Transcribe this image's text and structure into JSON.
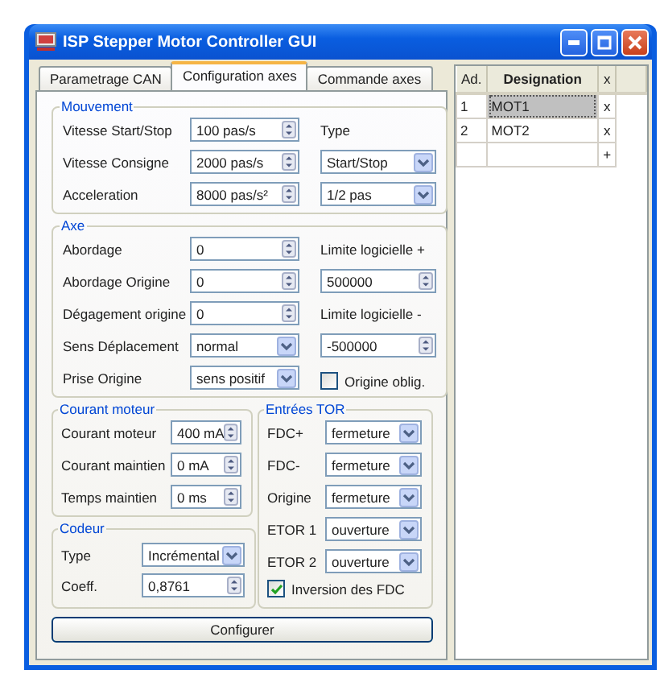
{
  "window": {
    "title": "ISP Stepper Motor Controller GUI"
  },
  "tabs": [
    {
      "label": "Parametrage CAN",
      "selected": false
    },
    {
      "label": "Configuration axes",
      "selected": true
    },
    {
      "label": "Commande axes",
      "selected": false
    }
  ],
  "groups": [
    {
      "title": "Mouvement",
      "rows": [
        {
          "label": "Vitesse Start/Stop",
          "field": {
            "kind": "spin",
            "value": "100 pas/s"
          },
          "side": {
            "kind": "label",
            "text": "Type"
          }
        },
        {
          "label": "Vitesse Consigne",
          "field": {
            "kind": "spin",
            "value": "2000 pas/s"
          },
          "side": {
            "kind": "combo",
            "value": "Start/Stop"
          }
        },
        {
          "label": "Acceleration",
          "field": {
            "kind": "spin",
            "value": "8000 pas/s²"
          },
          "side": {
            "kind": "combo",
            "value": "1/2 pas"
          }
        }
      ]
    },
    {
      "title": "Axe",
      "rows": [
        {
          "label": "Abordage",
          "field": {
            "kind": "spin",
            "value": "0"
          },
          "side": {
            "kind": "label",
            "text": "Limite logicielle +"
          }
        },
        {
          "label": "Abordage Origine",
          "field": {
            "kind": "spin",
            "value": "0"
          },
          "side": {
            "kind": "spin",
            "value": "500000"
          }
        },
        {
          "label": "Dégagement origine",
          "field": {
            "kind": "spin",
            "value": "0"
          },
          "side": {
            "kind": "label",
            "text": "Limite logicielle -"
          }
        },
        {
          "label": "Sens Déplacement",
          "field": {
            "kind": "combo",
            "value": "normal"
          },
          "side": {
            "kind": "spin",
            "value": "-500000"
          }
        },
        {
          "label": "Prise Origine",
          "field": {
            "kind": "combo",
            "value": "sens positif"
          },
          "side": {
            "kind": "check",
            "text": "Origine oblig.",
            "checked": false
          }
        }
      ]
    }
  ],
  "courant": {
    "title": "Courant moteur",
    "rows": [
      {
        "label": "Courant moteur",
        "field": {
          "kind": "spin",
          "value": "400 mA"
        }
      },
      {
        "label": "Courant maintien",
        "field": {
          "kind": "spin",
          "value": "0 mA"
        }
      },
      {
        "label": "Temps maintien",
        "field": {
          "kind": "spin",
          "value": "0 ms"
        }
      }
    ]
  },
  "codeur": {
    "title": "Codeur",
    "rows": [
      {
        "label": "Type",
        "field": {
          "kind": "combo",
          "value": "Incrémental"
        }
      },
      {
        "label": "Coeff.",
        "field": {
          "kind": "spin",
          "value": "0,8761"
        }
      }
    ]
  },
  "entrees": {
    "title": "Entrées TOR",
    "rows": [
      {
        "label": "FDC+",
        "field": {
          "kind": "combo",
          "value": "fermeture"
        }
      },
      {
        "label": "FDC-",
        "field": {
          "kind": "combo",
          "value": "fermeture"
        }
      },
      {
        "label": "Origine",
        "field": {
          "kind": "combo",
          "value": "fermeture"
        }
      },
      {
        "label": "ETOR 1",
        "field": {
          "kind": "combo",
          "value": "ouverture"
        }
      },
      {
        "label": "ETOR 2",
        "field": {
          "kind": "combo",
          "value": "ouverture"
        }
      }
    ],
    "check": {
      "text": "Inversion des FDC",
      "checked": true
    }
  },
  "configure_button": "Configurer",
  "table": {
    "columns": [
      "Ad.",
      "Designation",
      "x"
    ],
    "rows": [
      {
        "ad": "1",
        "designation": "MOT1",
        "action": "x",
        "selected": true
      },
      {
        "ad": "2",
        "designation": "MOT2",
        "action": "x",
        "selected": false
      },
      {
        "action": "+",
        "selected": false
      }
    ]
  }
}
